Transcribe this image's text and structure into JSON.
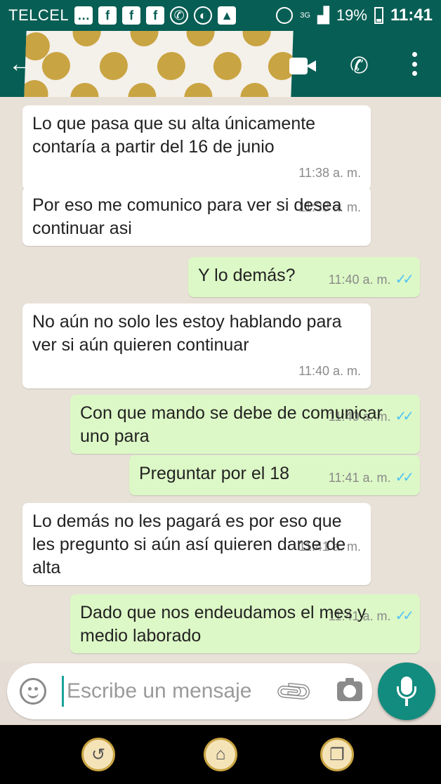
{
  "statusbar": {
    "carrier": "TELCEL",
    "network": "3G",
    "battery": "19%",
    "time": "11:41",
    "icons": [
      "message-icon",
      "facebook-icon",
      "facebook-icon",
      "facebook-icon",
      "whatsapp-icon",
      "app-icon",
      "image-icon"
    ]
  },
  "appbar": {
    "icons": [
      "back-arrow-icon",
      "video-call-icon",
      "phone-icon",
      "more-vertical-icon"
    ]
  },
  "messages": [
    {
      "dir": "in",
      "text": "Lo que pasa que su alta únicamente contaría a partir del 16 de junio",
      "time": "11:38 a. m."
    },
    {
      "dir": "in",
      "text": "Por eso me comunico para ver si desea continuar asi",
      "time": "11:38 a. m."
    },
    {
      "dir": "out",
      "text": "Y lo demás?",
      "time": "11:40 a. m.",
      "read": true
    },
    {
      "dir": "in",
      "text": "No aún no solo les estoy hablando para ver si aún quieren continuar",
      "time": "11:40 a. m."
    },
    {
      "dir": "out",
      "text": "Con que mando se debe de comunicar uno para",
      "time": "11:40 a. m.",
      "read": true
    },
    {
      "dir": "out",
      "text": "Preguntar por el 18",
      "time": "11:41 a. m.",
      "read": true
    },
    {
      "dir": "in",
      "text": "Lo demás no les pagará es por eso que les pregunto si aún así quieren darse de alta",
      "time": "11:41 a. m."
    },
    {
      "dir": "out",
      "text": "Dado que nos endeudamos el mes y medio laborado",
      "time": "11:41 a. m.",
      "read": true
    }
  ],
  "input": {
    "placeholder": "Escribe un mensaje"
  },
  "colors": {
    "header": "#075e54",
    "incoming": "#ffffff",
    "outgoing": "#dcf8c6",
    "read_tick": "#4fc3f7",
    "fab": "#128c7e"
  }
}
